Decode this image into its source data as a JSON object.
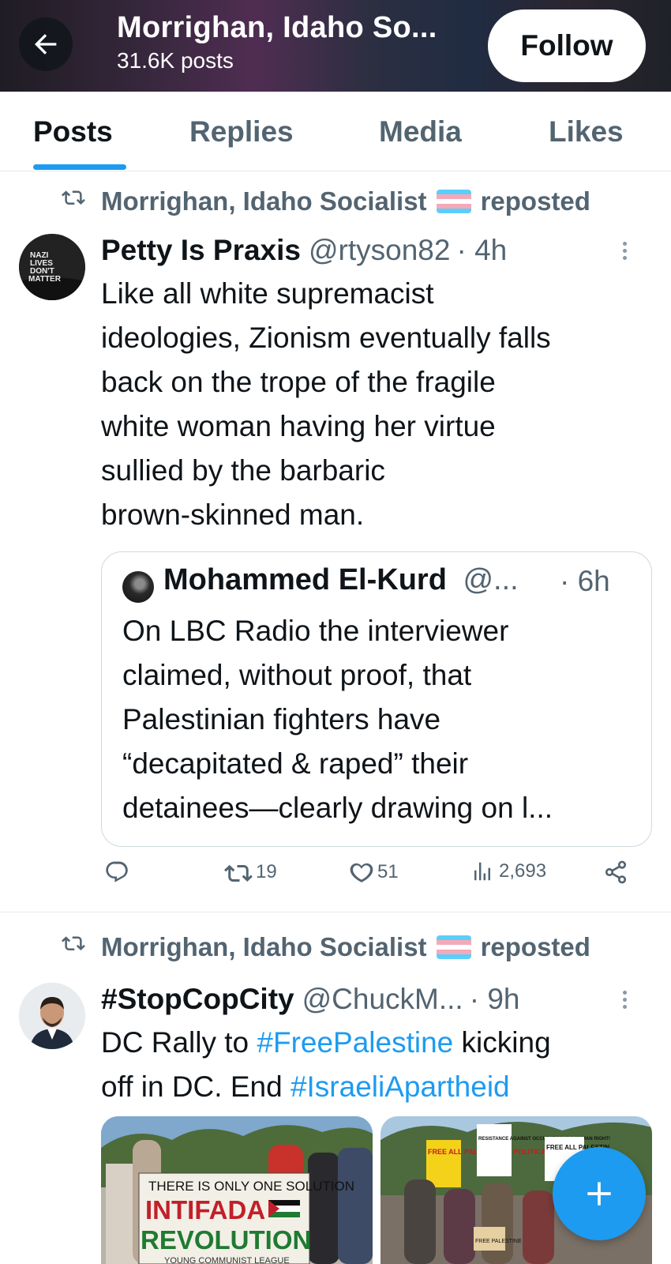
{
  "header": {
    "title": "Morrighan, Idaho So...",
    "subtitle": "31.6K posts",
    "follow_label": "Follow"
  },
  "tabs": [
    {
      "label": "Posts",
      "active": true
    },
    {
      "label": "Replies",
      "active": false
    },
    {
      "label": "Media",
      "active": false
    },
    {
      "label": "Likes",
      "active": false
    }
  ],
  "posts": [
    {
      "repost_by": "Morrighan, Idaho Socialist",
      "repost_suffix": "reposted",
      "author_name": "Petty Is Praxis",
      "handle": "@rtyson82",
      "time": "· 4h",
      "avatar_text": "NAZI LIVES DON'T MATTER",
      "text_lines": [
        "Like all white supremacist",
        "ideologies, Zionism eventually falls",
        "back on the trope of the fragile",
        "white woman having her virtue",
        "sullied by the barbaric",
        "brown-skinned man."
      ],
      "quote": {
        "author_name": "Mohammed El-Kurd",
        "handle": "@...",
        "time": "· 6h",
        "text_lines": [
          "On LBC Radio the interviewer",
          "claimed, without proof, that",
          "Palestinian fighters have",
          "“decapitated & raped” their",
          "detainees—clearly drawing on l..."
        ]
      },
      "stats": {
        "retweets": "19",
        "likes": "51",
        "views": "2,693"
      }
    },
    {
      "repost_by": "Morrighan, Idaho Socialist",
      "repost_suffix": "reposted",
      "author_name": "#StopCopCity",
      "handle": "@ChuckM...",
      "time": "· 9h",
      "text_line1_prefix": "DC Rally to ",
      "text_line1_hashtag": "#FreePalestine",
      "text_line1_suffix": " kicking",
      "text_line2_prefix": "off in DC. End ",
      "text_line2_hashtag": "#IsraeliApartheid",
      "media_left_texts": [
        "THERE IS ONLY ONE SOLUTION",
        "INTIFADA",
        "REVOLUTION",
        "YOUNG COMMUNIST LEAGUE"
      ],
      "media_right_texts": [
        "FREE ALL PALESTINIAN POLITICAL PRISONERS!",
        "RESISTANCE AGAINST OCCUPATION IS A HUMAN RIGHT!",
        "FREE ALL PALESTIN",
        "FREE PALESTINE"
      ]
    }
  ],
  "colors": {
    "accent": "#1d9bf0",
    "secondary_text": "#536471"
  },
  "icons": [
    "back-arrow-icon",
    "repost-icon",
    "more-icon",
    "reply-icon",
    "retweet-icon",
    "like-icon",
    "views-icon",
    "share-icon",
    "compose-plus-icon"
  ]
}
